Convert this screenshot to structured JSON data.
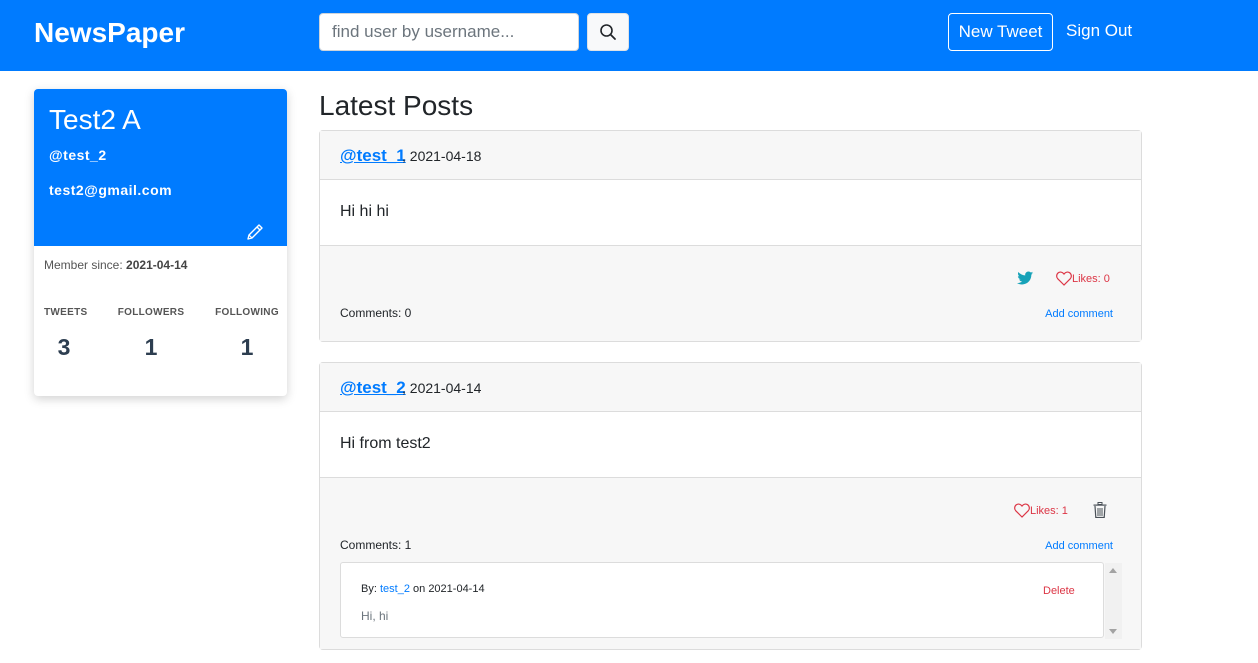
{
  "navbar": {
    "brand": "NewsPaper",
    "search_placeholder": "find user by username...",
    "search_value": "",
    "new_tweet_label": "New Tweet",
    "signout_label": "Sign Out",
    "color": "#007bff"
  },
  "profile": {
    "name": "Test2 A",
    "username": "@test_2",
    "email": "test2@gmail.com",
    "member_since_label": "Member since:",
    "member_since": "2021-04-14",
    "stats": [
      {
        "label": "TWEETS",
        "value": "3"
      },
      {
        "label": "FOLLOWERS",
        "value": "1"
      },
      {
        "label": "FOLLOWING",
        "value": "1"
      }
    ]
  },
  "main": {
    "title": "Latest Posts",
    "posts": [
      {
        "author": "@test_1",
        "date": "2021-04-18",
        "body": "Hi hi hi",
        "likes_label": "Likes: 0",
        "comments_label": "Comments: 0",
        "add_comment_label": "Add comment",
        "icons": [
          "twitter-icon",
          "heart-icon"
        ]
      },
      {
        "author": "@test_2",
        "date": "2021-04-14",
        "body": "Hi from test2",
        "likes_label": "Likes: 1",
        "comments_label": "Comments: 1",
        "add_comment_label": "Add comment",
        "icons": [
          "heart-icon",
          "trash-icon"
        ],
        "comments": [
          {
            "by_label": "By:",
            "user": "test_2",
            "on_label": "on",
            "date": "2021-04-14",
            "text": "Hi, hi",
            "delete_label": "Delete"
          }
        ]
      }
    ]
  }
}
